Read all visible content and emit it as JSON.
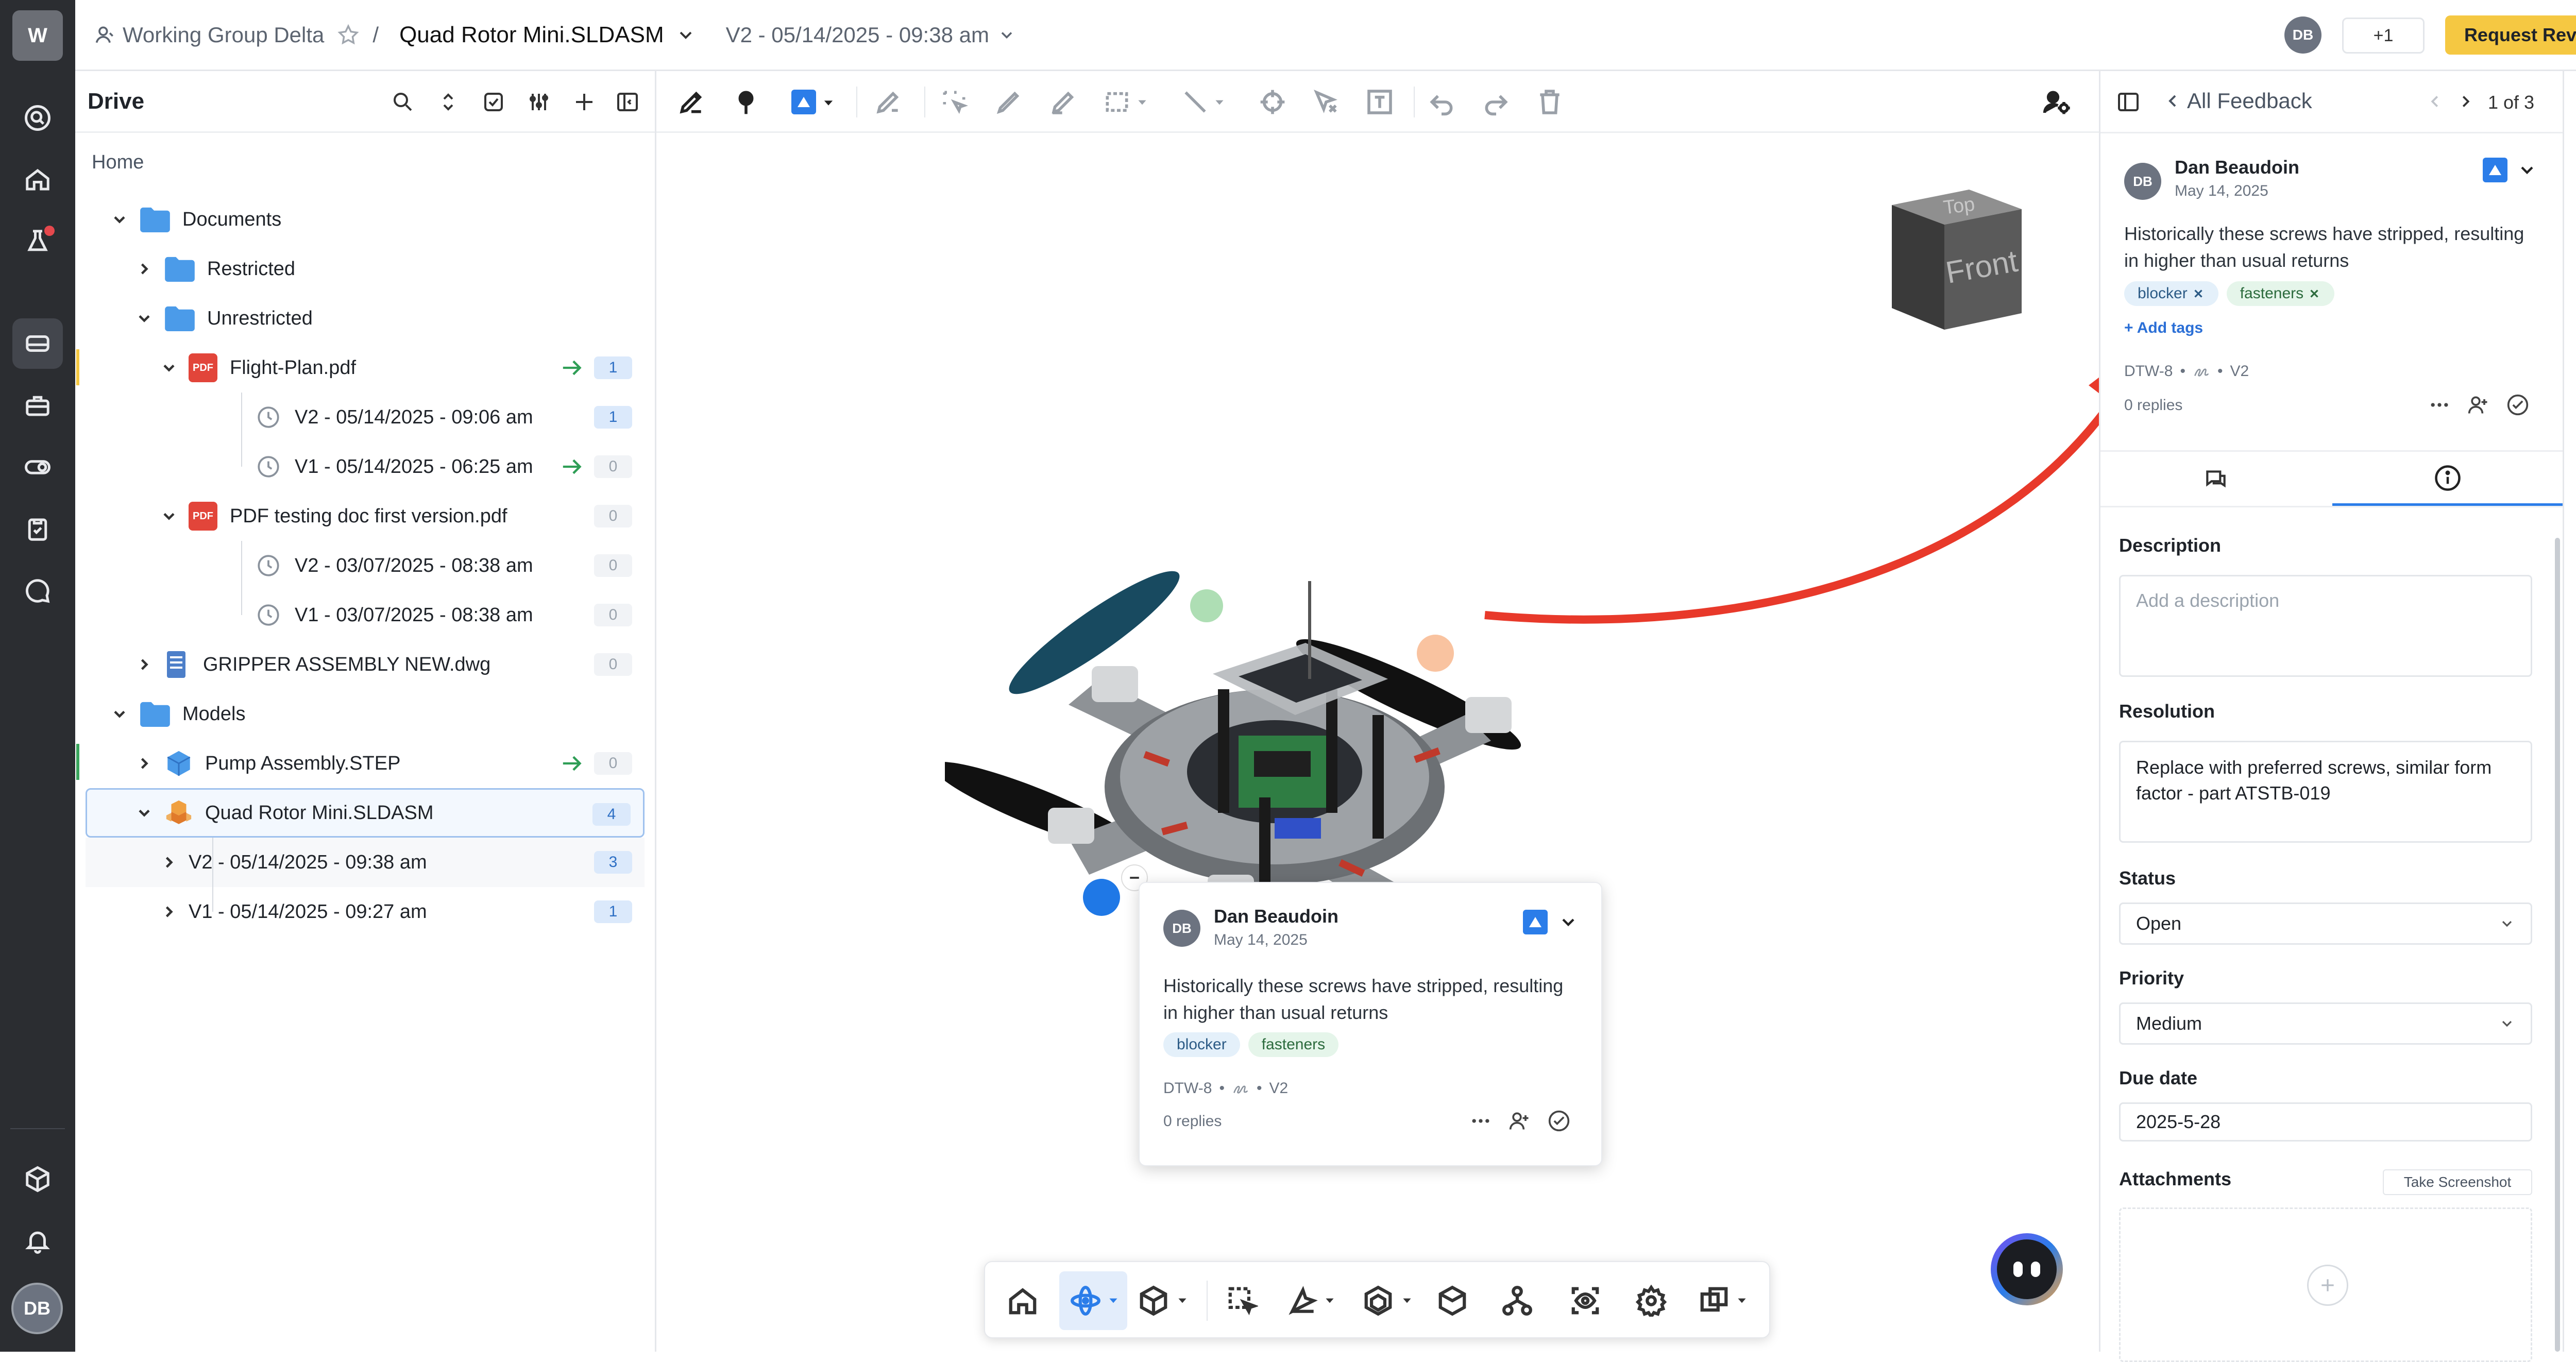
{
  "workspace_initial": "W",
  "header": {
    "group": "Working Group Delta",
    "separator": "/",
    "file_name": "Quad Rotor Mini.SLDASM",
    "version": "V2 - 05/14/2025 - 09:38 am",
    "user_initials": "DB",
    "share_count": "+1",
    "request_review": "Request Review"
  },
  "drive": {
    "title": "Drive",
    "home": "Home",
    "items": [
      {
        "label": "Documents",
        "badge": ""
      },
      {
        "label": "Restricted",
        "badge": ""
      },
      {
        "label": "Unrestricted",
        "badge": ""
      },
      {
        "label": "Flight-Plan.pdf",
        "badge": "1"
      },
      {
        "label": "V2 - 05/14/2025 - 09:06 am",
        "badge": "1"
      },
      {
        "label": "V1 - 05/14/2025 - 06:25 am",
        "badge": "0"
      },
      {
        "label": "PDF testing doc first version.pdf",
        "badge": "0"
      },
      {
        "label": "V2 - 03/07/2025 - 08:38 am",
        "badge": "0"
      },
      {
        "label": "V1 - 03/07/2025 - 08:38 am",
        "badge": "0"
      },
      {
        "label": "GRIPPER ASSEMBLY NEW.dwg",
        "badge": "0"
      },
      {
        "label": "Models",
        "badge": ""
      },
      {
        "label": "Pump Assembly.STEP",
        "badge": "0"
      },
      {
        "label": "Quad Rotor Mini.SLDASM",
        "badge": "4"
      },
      {
        "label": "V2 - 05/14/2025 - 09:38 am",
        "badge": "3"
      },
      {
        "label": "V1 - 05/14/2025 - 09:27 am",
        "badge": "1"
      }
    ],
    "pdf_label": "PDF"
  },
  "viewcube": {
    "top": "Top",
    "front": "Front"
  },
  "feedback": {
    "back_label": "All Feedback",
    "pager": "1 of 3",
    "author": "Dan Beaudoin",
    "author_initials": "DB",
    "date": "May 14, 2025",
    "text": "Historically these screws have stripped, resulting in higher than usual returns",
    "tags": [
      "blocker",
      "fasteners"
    ],
    "add_tags": "+ Add tags",
    "ref": "DTW-8",
    "version": "V2",
    "replies": "0 replies",
    "description_label": "Description",
    "description_placeholder": "Add a description",
    "resolution_label": "Resolution",
    "resolution_value": "Replace with preferred screws, similar form factor - part ATSTB-019",
    "status_label": "Status",
    "status_value": "Open",
    "priority_label": "Priority",
    "priority_value": "Medium",
    "due_label": "Due date",
    "due_value": "2025-5-28",
    "attachments_label": "Attachments",
    "take_screenshot": "Take Screenshot"
  },
  "card": {
    "author": "Dan Beaudoin",
    "author_initials": "DB",
    "date": "May 14, 2025",
    "text": "Historically these screws have stripped, resulting in higher than usual returns",
    "tags": [
      "blocker",
      "fasteners"
    ],
    "ref": "DTW-8",
    "version": "V2",
    "replies": "0 replies"
  },
  "right_rail": {
    "feedback_count": "3"
  },
  "colors": {
    "accent": "#2b7de9",
    "request_review": "#f5c842",
    "annotation_arrow": "#e8392a"
  }
}
